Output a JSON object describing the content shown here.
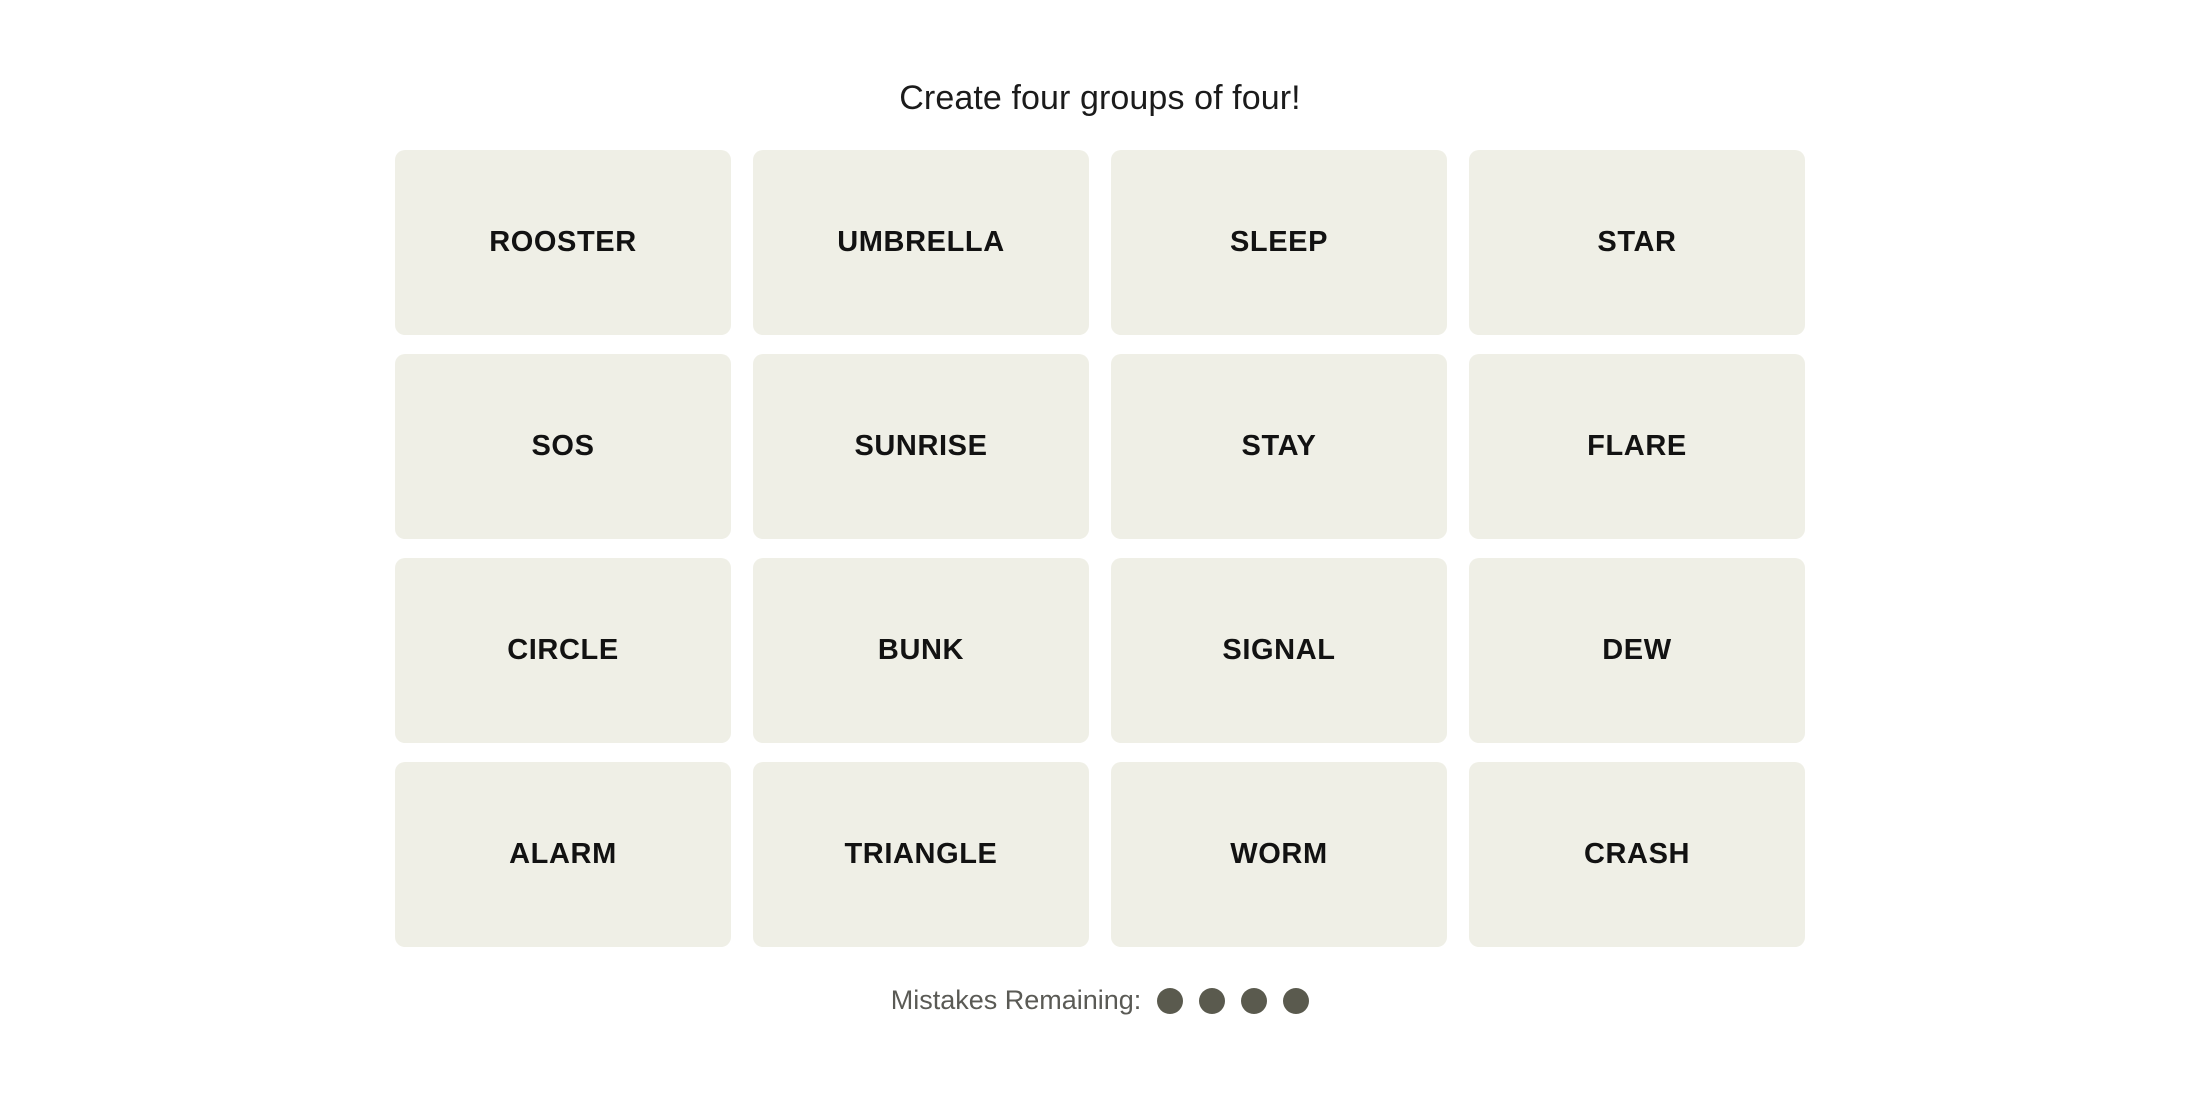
{
  "page": {
    "background_color": "#ffffff"
  },
  "header": {
    "instruction": "Create four groups of four!"
  },
  "board": {
    "tile_background_color": "#efefe6",
    "tile_text_color": "#121212",
    "rows": 4,
    "columns": 4,
    "tiles": [
      {
        "label": "ROOSTER"
      },
      {
        "label": "UMBRELLA"
      },
      {
        "label": "SLEEP"
      },
      {
        "label": "STAR"
      },
      {
        "label": "SOS"
      },
      {
        "label": "SUNRISE"
      },
      {
        "label": "STAY"
      },
      {
        "label": "FLARE"
      },
      {
        "label": "CIRCLE"
      },
      {
        "label": "BUNK"
      },
      {
        "label": "SIGNAL"
      },
      {
        "label": "DEW"
      },
      {
        "label": "ALARM"
      },
      {
        "label": "TRIANGLE"
      },
      {
        "label": "WORM"
      },
      {
        "label": "CRASH"
      }
    ]
  },
  "footer": {
    "mistakes_label": "Mistakes Remaining:",
    "mistakes_remaining": 4,
    "dot_color": "#5a5a4e",
    "dots": [
      {
        "state": "filled"
      },
      {
        "state": "filled"
      },
      {
        "state": "filled"
      },
      {
        "state": "filled"
      }
    ]
  }
}
